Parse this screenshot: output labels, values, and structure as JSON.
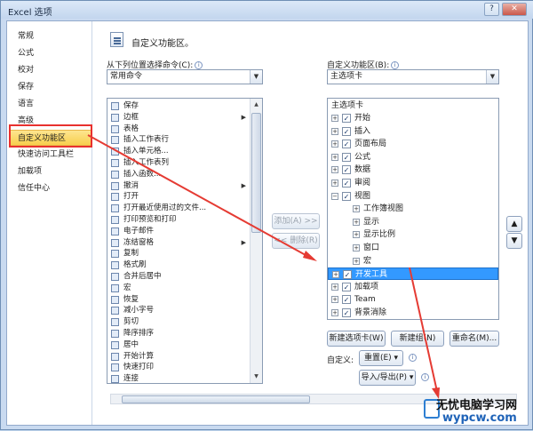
{
  "window": {
    "title": "Excel 选项",
    "help": "?",
    "close": "✕"
  },
  "nav": {
    "items": [
      {
        "label": "常规"
      },
      {
        "label": "公式"
      },
      {
        "label": "校对"
      },
      {
        "label": "保存"
      },
      {
        "label": "语言"
      },
      {
        "label": "高级"
      },
      {
        "label": "自定义功能区",
        "selected": true
      },
      {
        "label": "快速访问工具栏"
      },
      {
        "label": "加载项"
      },
      {
        "label": "信任中心"
      }
    ]
  },
  "header": {
    "title": "自定义功能区。"
  },
  "left": {
    "label": "从下列位置选择命令(C):",
    "combo": "常用命令",
    "commands": [
      "保存",
      "边框",
      "表格",
      "插入工作表行",
      "插入单元格...",
      "插入工作表列",
      "插入函数...",
      "撤消",
      "打开",
      "打开最近使用过的文件...",
      "打印预览和打印",
      "电子邮件",
      "冻结窗格",
      "复制",
      "格式刷",
      "合并后居中",
      "宏",
      "恢复",
      "减小字号",
      "剪切",
      "降序排序",
      "居中",
      "开始计算",
      "快速打印",
      "连接"
    ]
  },
  "middle": {
    "add": "添加(A) >>",
    "remove": "<< 删除(R)"
  },
  "right": {
    "label": "自定义功能区(B):",
    "combo": "主选项卡",
    "root": "主选项卡",
    "tree": [
      {
        "label": "开始",
        "level": 0,
        "expand": "+",
        "checked": true
      },
      {
        "label": "插入",
        "level": 0,
        "expand": "+",
        "checked": true
      },
      {
        "label": "页面布局",
        "level": 0,
        "expand": "+",
        "checked": true
      },
      {
        "label": "公式",
        "level": 0,
        "expand": "+",
        "checked": true
      },
      {
        "label": "数据",
        "level": 0,
        "expand": "+",
        "checked": true
      },
      {
        "label": "审阅",
        "level": 0,
        "expand": "+",
        "checked": true
      },
      {
        "label": "视图",
        "level": 0,
        "expand": "−",
        "checked": true
      },
      {
        "label": "工作簿视图",
        "level": 1,
        "expand": "+"
      },
      {
        "label": "显示",
        "level": 1,
        "expand": "+"
      },
      {
        "label": "显示比例",
        "level": 1,
        "expand": "+"
      },
      {
        "label": "窗口",
        "level": 1,
        "expand": "+"
      },
      {
        "label": "宏",
        "level": 1,
        "expand": "+"
      },
      {
        "label": "开发工具",
        "level": 0,
        "expand": "+",
        "checked": true,
        "selected": true
      },
      {
        "label": "加载项",
        "level": 0,
        "expand": "+",
        "checked": true
      },
      {
        "label": "Team",
        "level": 0,
        "expand": "+",
        "checked": true
      },
      {
        "label": "背景消除",
        "level": 0,
        "expand": "+",
        "checked": true
      }
    ],
    "new_tab": "新建选项卡(W)",
    "new_group": "新建组(N)",
    "rename": "重命名(M)...",
    "customize_label": "自定义:",
    "reset": "重置(E) ▾",
    "import_export": "导入/导出(P) ▾",
    "move_up": "▲",
    "move_down": "▼"
  },
  "watermark": {
    "line1": "无忧电脑学习网",
    "line2": "wypcw.com"
  }
}
